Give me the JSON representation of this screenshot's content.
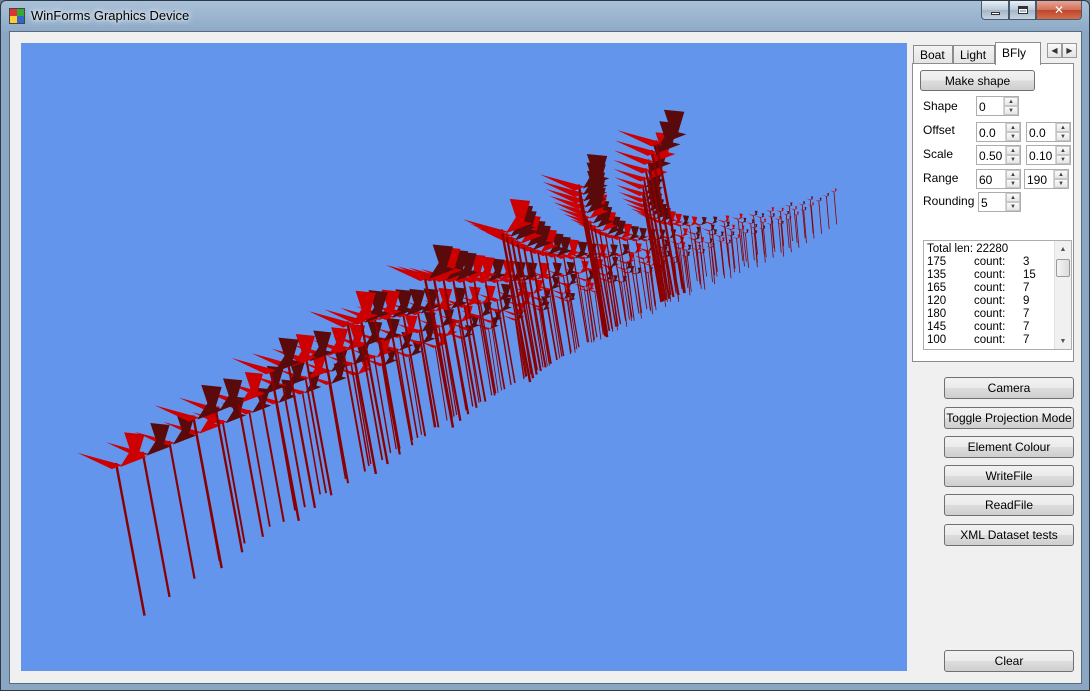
{
  "window": {
    "title": "WinForms Graphics Device",
    "minimize_label": "",
    "close_label": "✕"
  },
  "tabs": {
    "items": [
      {
        "label": "Boat"
      },
      {
        "label": "Light"
      },
      {
        "label": "BFly"
      }
    ],
    "scroll_left": "◀",
    "scroll_right": "▶",
    "active": "BFly"
  },
  "bfly": {
    "make_shape_label": "Make shape",
    "shape_label": "Shape",
    "shape_value": "0",
    "offset_label": "Offset",
    "offset_x": "0.0",
    "offset_y": "0.0",
    "scale_label": "Scale",
    "scale_x": "0.50",
    "scale_y": "0.10",
    "range_label": "Range",
    "range_min": "60",
    "range_max": "190",
    "rounding_label": "Rounding",
    "rounding_value": "5",
    "list": {
      "header": "Total len: 22280",
      "rows": [
        {
          "value": "175",
          "label": "count:",
          "count": "3"
        },
        {
          "value": "135",
          "label": "count:",
          "count": "15"
        },
        {
          "value": "165",
          "label": "count:",
          "count": "7"
        },
        {
          "value": "120",
          "label": "count:",
          "count": "9"
        },
        {
          "value": "180",
          "label": "count:",
          "count": "7"
        },
        {
          "value": "145",
          "label": "count:",
          "count": "7"
        },
        {
          "value": "100",
          "label": "count:",
          "count": "7"
        }
      ]
    }
  },
  "actions": {
    "camera": "Camera",
    "toggle_projection": "Toggle Projection Mode",
    "element_colour": "Element Colour",
    "write_file": "WriteFile",
    "read_file": "ReadFile",
    "xml_tests": "XML Dataset tests",
    "clear": "Clear"
  },
  "colors": {
    "viewport_bg": "#6495ed",
    "butterfly_dark": "#5a0a0a",
    "butterfly_red": "#cc0000",
    "stem": "#8a0000"
  },
  "icons": {
    "app": "app-icon",
    "minimize": "minimize-icon",
    "maximize": "maximize-icon",
    "close": "close-icon"
  }
}
